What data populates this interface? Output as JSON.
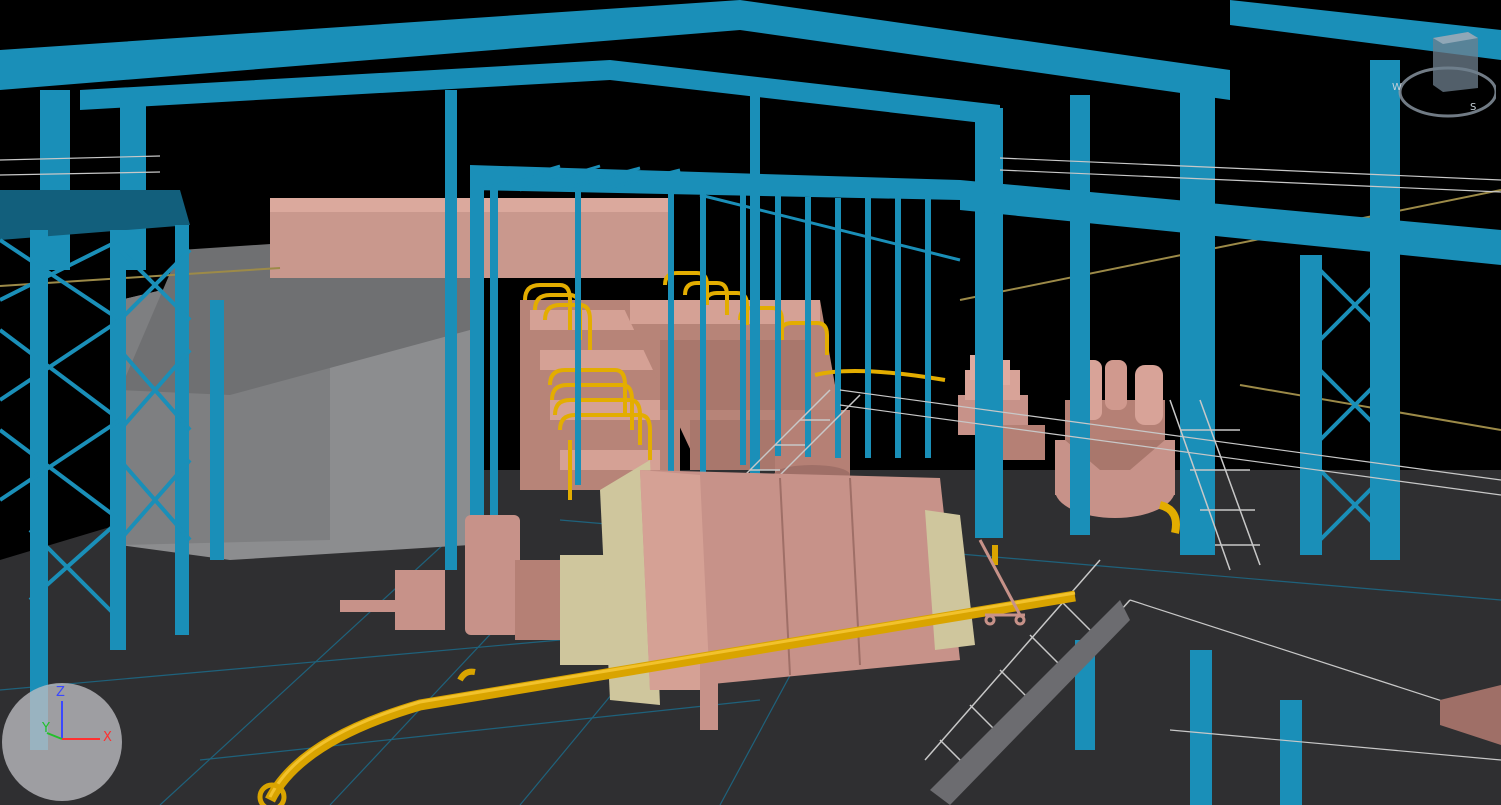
{
  "viewport": {
    "background": "#000000",
    "colors": {
      "steel": "#1a8fb8",
      "steel_dark": "#0f6f93",
      "steel_light": "#2aa6d0",
      "floor": "#2f2f31",
      "floor_line": "#1f7fa0",
      "equipment": "#c79289",
      "equipment_dark": "#9f6f67",
      "equipment_light": "#e0aba0",
      "flange": "#cfc69d",
      "pipe": "#d9a400",
      "pipe_dark": "#a77d00",
      "wall_grey": "#8c8d8f",
      "wall_pink": "#c9988d",
      "rail": "#c8c8c8"
    }
  },
  "axis_gizmo": {
    "z_label": "Z",
    "y_label": "Y",
    "x_label": "X",
    "z_color": "#3a48ff",
    "y_color": "#22c02a",
    "x_color": "#ff3030"
  },
  "view_cube": {
    "w_label": "W",
    "s_label": "S"
  }
}
